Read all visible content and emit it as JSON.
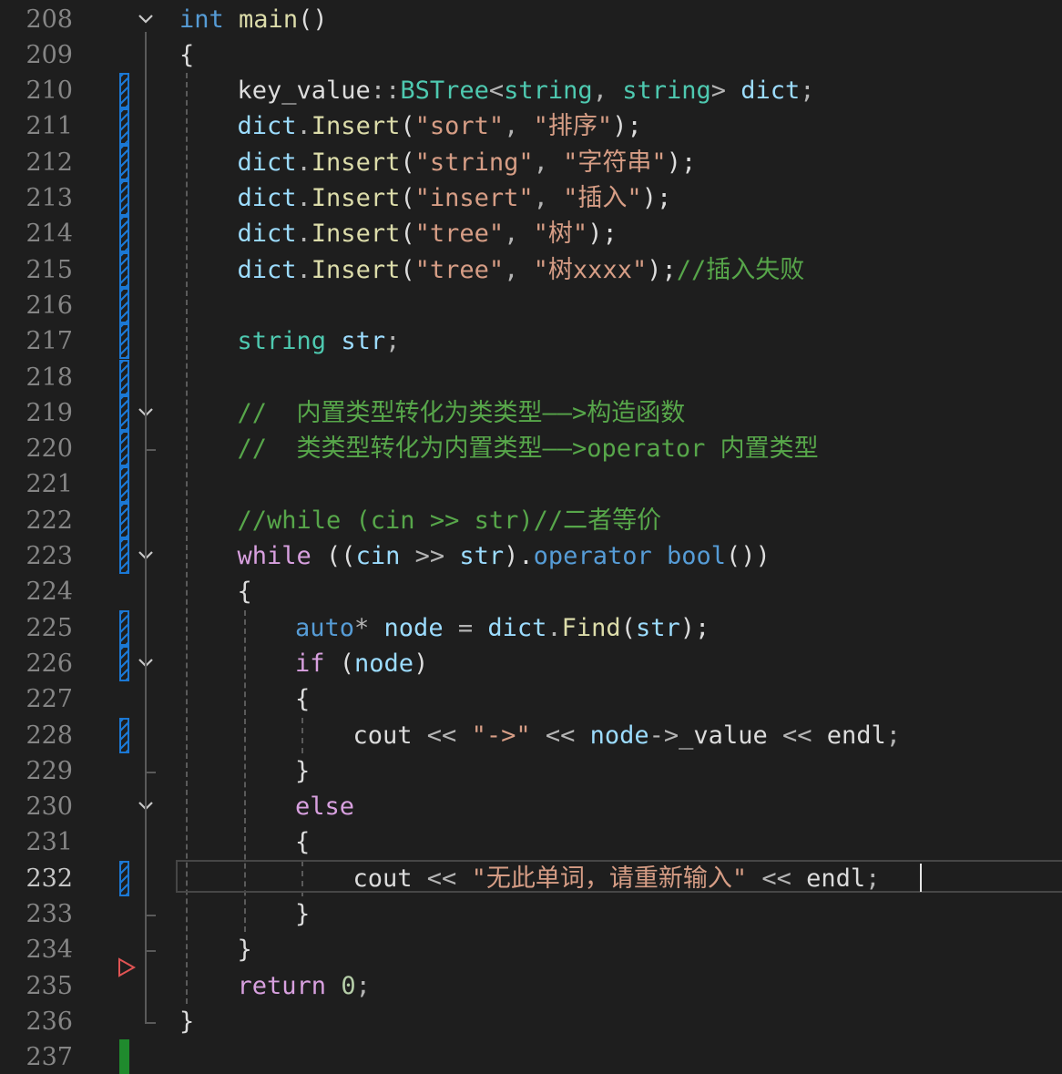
{
  "editor": {
    "lines": [
      {
        "n": "208",
        "change": "",
        "fold": true,
        "indent": 0,
        "tokens": [
          {
            "t": "int",
            "c": "kw"
          },
          {
            "t": " ",
            "c": "sp"
          },
          {
            "t": "main",
            "c": "fn"
          },
          {
            "t": "()",
            "c": "pl"
          }
        ]
      },
      {
        "n": "209",
        "change": "",
        "fold": false,
        "indent": 0,
        "tokens": [
          {
            "t": "{",
            "c": "pl"
          }
        ]
      },
      {
        "n": "210",
        "change": "modified",
        "fold": false,
        "indent": 1,
        "tokens": [
          {
            "t": "key_value",
            "c": "pl"
          },
          {
            "t": "::",
            "c": "op"
          },
          {
            "t": "BSTree",
            "c": "ty"
          },
          {
            "t": "<",
            "c": "op"
          },
          {
            "t": "string",
            "c": "ty"
          },
          {
            "t": ", ",
            "c": "op"
          },
          {
            "t": "string",
            "c": "ty"
          },
          {
            "t": "> ",
            "c": "op"
          },
          {
            "t": "dict",
            "c": "var"
          },
          {
            "t": ";",
            "c": "op"
          }
        ]
      },
      {
        "n": "211",
        "change": "modified",
        "fold": false,
        "indent": 1,
        "tokens": [
          {
            "t": "dict",
            "c": "var"
          },
          {
            "t": ".",
            "c": "op"
          },
          {
            "t": "Insert",
            "c": "fn"
          },
          {
            "t": "(",
            "c": "pl"
          },
          {
            "t": "\"sort\"",
            "c": "str"
          },
          {
            "t": ", ",
            "c": "op"
          },
          {
            "t": "\"排序\"",
            "c": "str"
          },
          {
            "t": ");",
            "c": "pl"
          }
        ]
      },
      {
        "n": "212",
        "change": "modified",
        "fold": false,
        "indent": 1,
        "tokens": [
          {
            "t": "dict",
            "c": "var"
          },
          {
            "t": ".",
            "c": "op"
          },
          {
            "t": "Insert",
            "c": "fn"
          },
          {
            "t": "(",
            "c": "pl"
          },
          {
            "t": "\"string\"",
            "c": "str"
          },
          {
            "t": ", ",
            "c": "op"
          },
          {
            "t": "\"字符串\"",
            "c": "str"
          },
          {
            "t": ");",
            "c": "pl"
          }
        ]
      },
      {
        "n": "213",
        "change": "modified",
        "fold": false,
        "indent": 1,
        "tokens": [
          {
            "t": "dict",
            "c": "var"
          },
          {
            "t": ".",
            "c": "op"
          },
          {
            "t": "Insert",
            "c": "fn"
          },
          {
            "t": "(",
            "c": "pl"
          },
          {
            "t": "\"insert\"",
            "c": "str"
          },
          {
            "t": ", ",
            "c": "op"
          },
          {
            "t": "\"插入\"",
            "c": "str"
          },
          {
            "t": ");",
            "c": "pl"
          }
        ]
      },
      {
        "n": "214",
        "change": "modified",
        "fold": false,
        "indent": 1,
        "tokens": [
          {
            "t": "dict",
            "c": "var"
          },
          {
            "t": ".",
            "c": "op"
          },
          {
            "t": "Insert",
            "c": "fn"
          },
          {
            "t": "(",
            "c": "pl"
          },
          {
            "t": "\"tree\"",
            "c": "str"
          },
          {
            "t": ", ",
            "c": "op"
          },
          {
            "t": "\"树\"",
            "c": "str"
          },
          {
            "t": ");",
            "c": "pl"
          }
        ]
      },
      {
        "n": "215",
        "change": "modified",
        "fold": false,
        "indent": 1,
        "tokens": [
          {
            "t": "dict",
            "c": "var"
          },
          {
            "t": ".",
            "c": "op"
          },
          {
            "t": "Insert",
            "c": "fn"
          },
          {
            "t": "(",
            "c": "pl"
          },
          {
            "t": "\"tree\"",
            "c": "str"
          },
          {
            "t": ", ",
            "c": "op"
          },
          {
            "t": "\"树xxxx\"",
            "c": "str"
          },
          {
            "t": ");",
            "c": "pl"
          },
          {
            "t": "//插入失败",
            "c": "cm"
          }
        ]
      },
      {
        "n": "216",
        "change": "modified",
        "fold": false,
        "indent": 1,
        "tokens": []
      },
      {
        "n": "217",
        "change": "modified",
        "fold": false,
        "indent": 1,
        "tokens": [
          {
            "t": "string",
            "c": "ty"
          },
          {
            "t": " ",
            "c": "sp"
          },
          {
            "t": "str",
            "c": "var"
          },
          {
            "t": ";",
            "c": "op"
          }
        ]
      },
      {
        "n": "218",
        "change": "modified",
        "fold": false,
        "indent": 1,
        "tokens": []
      },
      {
        "n": "219",
        "change": "modified",
        "fold": true,
        "indent": 1,
        "tokens": [
          {
            "t": "//  内置类型转化为类类型——>构造函数",
            "c": "cm"
          }
        ]
      },
      {
        "n": "220",
        "change": "modified",
        "fold": false,
        "indent": 1,
        "tokens": [
          {
            "t": "//  类类型转化为内置类型——>operator 内置类型",
            "c": "cm"
          }
        ]
      },
      {
        "n": "221",
        "change": "modified",
        "fold": false,
        "indent": 1,
        "tokens": []
      },
      {
        "n": "222",
        "change": "modified",
        "fold": false,
        "indent": 1,
        "tokens": [
          {
            "t": "//while (cin >> str)//二者等价",
            "c": "cm"
          }
        ]
      },
      {
        "n": "223",
        "change": "modified",
        "fold": true,
        "indent": 1,
        "tokens": [
          {
            "t": "while",
            "c": "ctl"
          },
          {
            "t": " ((",
            "c": "pl"
          },
          {
            "t": "cin",
            "c": "var"
          },
          {
            "t": " >> ",
            "c": "op"
          },
          {
            "t": "str",
            "c": "var"
          },
          {
            "t": ").",
            "c": "pl"
          },
          {
            "t": "operator bool",
            "c": "kw"
          },
          {
            "t": "())",
            "c": "pl"
          }
        ]
      },
      {
        "n": "224",
        "change": "",
        "fold": false,
        "indent": 1,
        "tokens": [
          {
            "t": "{",
            "c": "pl"
          }
        ]
      },
      {
        "n": "225",
        "change": "modified",
        "fold": false,
        "indent": 2,
        "tokens": [
          {
            "t": "auto",
            "c": "kw"
          },
          {
            "t": "* ",
            "c": "op"
          },
          {
            "t": "node",
            "c": "var"
          },
          {
            "t": " = ",
            "c": "op"
          },
          {
            "t": "dict",
            "c": "var"
          },
          {
            "t": ".",
            "c": "op"
          },
          {
            "t": "Find",
            "c": "fn"
          },
          {
            "t": "(",
            "c": "pl"
          },
          {
            "t": "str",
            "c": "var"
          },
          {
            "t": ");",
            "c": "pl"
          }
        ]
      },
      {
        "n": "226",
        "change": "modified",
        "fold": true,
        "indent": 2,
        "tokens": [
          {
            "t": "if",
            "c": "ctl"
          },
          {
            "t": " (",
            "c": "pl"
          },
          {
            "t": "node",
            "c": "var"
          },
          {
            "t": ")",
            "c": "pl"
          }
        ]
      },
      {
        "n": "227",
        "change": "",
        "fold": false,
        "indent": 2,
        "tokens": [
          {
            "t": "{",
            "c": "pl"
          }
        ]
      },
      {
        "n": "228",
        "change": "modified",
        "fold": false,
        "indent": 3,
        "tokens": [
          {
            "t": "cout",
            "c": "pl"
          },
          {
            "t": " << ",
            "c": "op"
          },
          {
            "t": "\"->\"",
            "c": "str"
          },
          {
            "t": " << ",
            "c": "op"
          },
          {
            "t": "node",
            "c": "var"
          },
          {
            "t": "->",
            "c": "op"
          },
          {
            "t": "_value",
            "c": "pl"
          },
          {
            "t": " << ",
            "c": "op"
          },
          {
            "t": "endl",
            "c": "pl"
          },
          {
            "t": ";",
            "c": "op"
          }
        ]
      },
      {
        "n": "229",
        "change": "",
        "fold": false,
        "indent": 2,
        "tokens": [
          {
            "t": "}",
            "c": "pl"
          }
        ]
      },
      {
        "n": "230",
        "change": "",
        "fold": true,
        "indent": 2,
        "tokens": [
          {
            "t": "else",
            "c": "ctl"
          }
        ]
      },
      {
        "n": "231",
        "change": "",
        "fold": false,
        "indent": 2,
        "tokens": [
          {
            "t": "{",
            "c": "pl"
          }
        ]
      },
      {
        "n": "232",
        "change": "modified",
        "fold": false,
        "indent": 3,
        "current": true,
        "tokens": [
          {
            "t": "cout",
            "c": "pl"
          },
          {
            "t": " << ",
            "c": "op"
          },
          {
            "t": "\"无此单词，请重新输入\"",
            "c": "str"
          },
          {
            "t": " << ",
            "c": "op"
          },
          {
            "t": "endl",
            "c": "pl"
          },
          {
            "t": ";",
            "c": "op"
          }
        ]
      },
      {
        "n": "233",
        "change": "",
        "fold": false,
        "indent": 2,
        "tokens": [
          {
            "t": "}",
            "c": "pl"
          }
        ]
      },
      {
        "n": "234",
        "change": "",
        "fold": false,
        "indent": 1,
        "tokens": [
          {
            "t": "}",
            "c": "pl"
          }
        ]
      },
      {
        "n": "235",
        "change": "",
        "fold": false,
        "indent": 1,
        "breakpoint": true,
        "tokens": [
          {
            "t": "return",
            "c": "ctl"
          },
          {
            "t": " ",
            "c": "sp"
          },
          {
            "t": "0",
            "c": "num"
          },
          {
            "t": ";",
            "c": "op"
          }
        ]
      },
      {
        "n": "236",
        "change": "",
        "fold": false,
        "indent": 0,
        "tokens": [
          {
            "t": "}",
            "c": "pl"
          }
        ]
      },
      {
        "n": "237",
        "change": "saved",
        "fold": false,
        "indent": 0,
        "tokens": []
      }
    ]
  }
}
